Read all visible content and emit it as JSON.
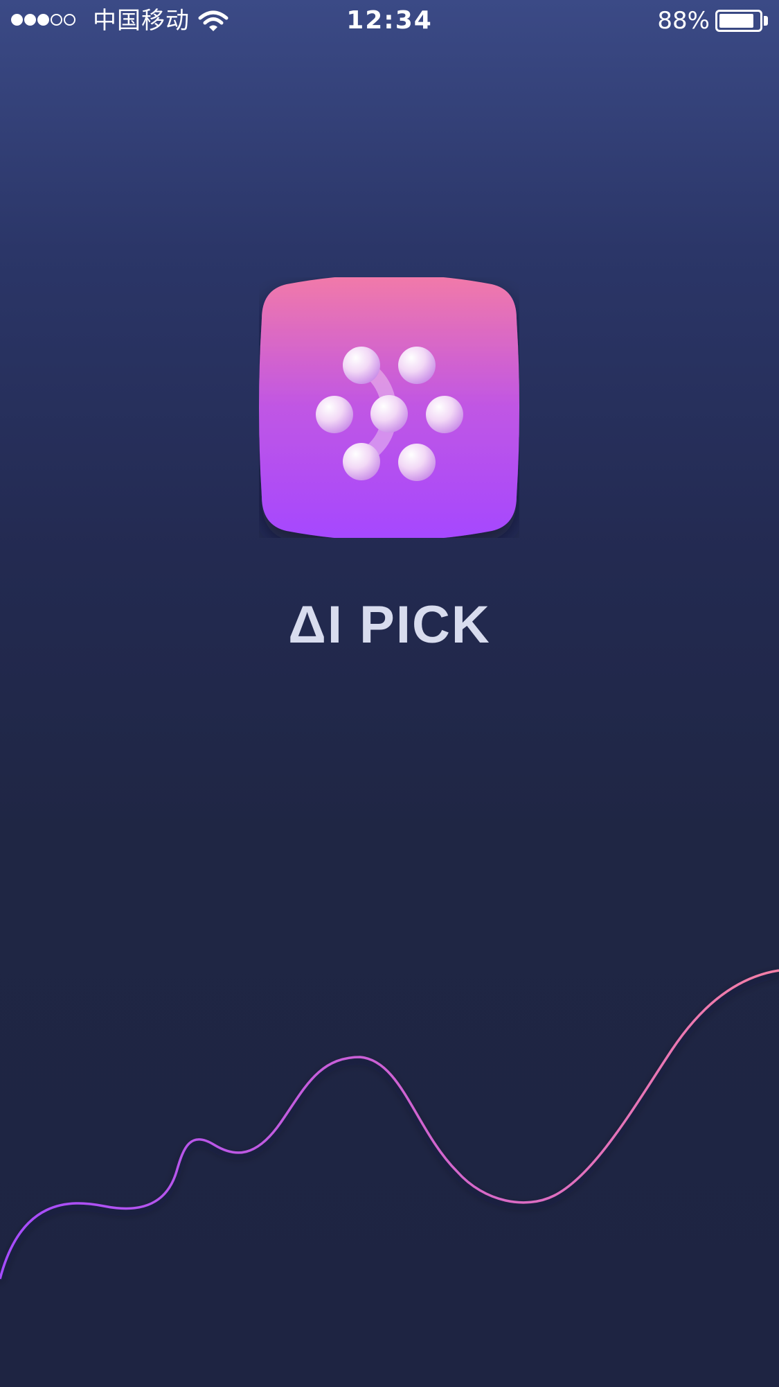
{
  "status_bar": {
    "signal_bars": {
      "filled": 3,
      "total": 5
    },
    "carrier": "中国移动",
    "time": "12:34",
    "battery_percent_label": "88%",
    "battery_level": 0.88
  },
  "app": {
    "name": "ΔI PICK",
    "brand_colors": {
      "logo_gradient_top": "#f27aa8",
      "logo_gradient_bottom": "#a548ff",
      "wave_start": "#a54cff",
      "wave_end": "#f57fa6"
    }
  },
  "icons": [
    "signal-icon",
    "wifi-icon",
    "battery-icon",
    "app-logo-icon"
  ]
}
